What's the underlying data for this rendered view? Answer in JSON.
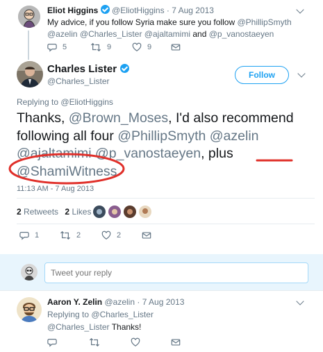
{
  "parent_tweet": {
    "name": "Eliot Higgins",
    "handle": "@EliotHiggins",
    "date": "· 7 Aug 2013",
    "text_prefix": "My advice, if you follow Syria make sure you follow ",
    "mention1": "@PhillipSmyth",
    "mention2": "@azelin",
    "mention3": "@Charles_Lister",
    "mention4": "@ajaltamimi",
    "and_word": "and",
    "mention5": "@p_vanostaeyen",
    "replies": "5",
    "retweets": "9",
    "likes": "9"
  },
  "main_tweet": {
    "name": "Charles Lister",
    "handle": "@Charles_Lister",
    "follow_label": "Follow",
    "replying_to_label": "Replying to",
    "replying_to_handle": "@EliotHiggins",
    "text_start": "Thanks,",
    "m_brown": "@Brown_Moses",
    "text_mid": ", I'd also recommend following all four",
    "m_phillip": "@PhillipSmyth",
    "m_azelin": "@azelin",
    "m_ajal": "@ajaltamimi",
    "m_pvan": "@p_vanostaeyen",
    "comma": ",",
    "plus_word": "plus",
    "m_shami": "@ShamiWitness",
    "period": ".",
    "timestamp": "11:13 AM - 7 Aug 2013",
    "retweets_count": "2",
    "retweets_label": "Retweets",
    "likes_count": "2",
    "likes_label": "Likes",
    "replies": "1",
    "retweets": "2",
    "likes": "2"
  },
  "reply_box": {
    "placeholder": "Tweet your reply"
  },
  "reply_tweet": {
    "name": "Aaron Y. Zelin",
    "handle": "@azelin",
    "date": "· 7 Aug 2013",
    "replying_to_label": "Replying to",
    "replying_to_handle": "@Charles_Lister",
    "mention": "@Charles_Lister",
    "text": "Thanks!"
  },
  "colors": {
    "accent": "#1da1f2",
    "annotation_red": "#e0302a"
  },
  "icons": [
    "reply-icon",
    "retweet-icon",
    "like-icon",
    "dm-icon",
    "verified-icon",
    "chevron-down-icon"
  ]
}
